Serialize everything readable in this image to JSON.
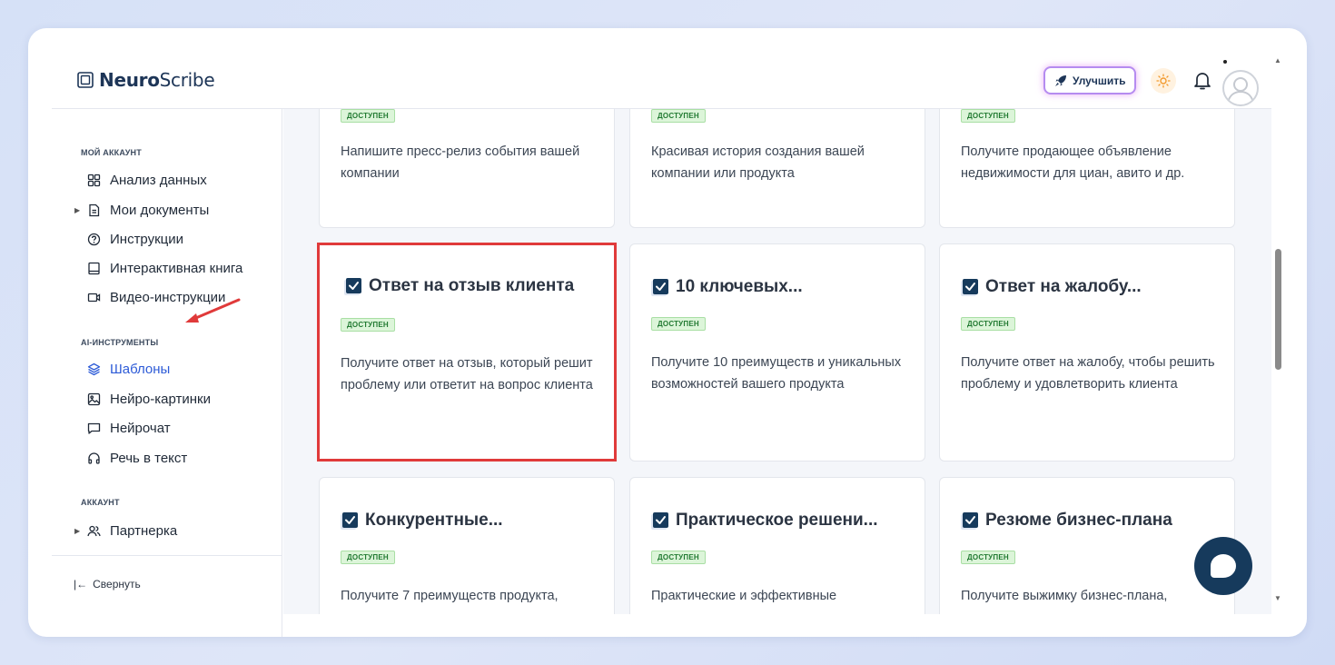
{
  "header": {
    "logo_bold": "Neuro",
    "logo_regular": "Scribe",
    "upgrade_label": "Улучшить"
  },
  "sidebar": {
    "section_account": "МОЙ АККАУНТ",
    "items_account": [
      {
        "label": "Анализ данных",
        "icon": "grid-icon"
      },
      {
        "label": "Мои документы",
        "icon": "document-icon"
      },
      {
        "label": "Инструкции",
        "icon": "help-circle-icon"
      },
      {
        "label": "Интерактивная книга",
        "icon": "book-icon"
      },
      {
        "label": "Видео-инструкции",
        "icon": "video-icon"
      }
    ],
    "section_ai": "AI-ИНСТРУМЕНТЫ",
    "items_ai": [
      {
        "label": "Шаблоны",
        "icon": "layers-icon"
      },
      {
        "label": "Нейро-картинки",
        "icon": "image-icon"
      },
      {
        "label": "Нейрочат",
        "icon": "chat-icon"
      },
      {
        "label": "Речь в текст",
        "icon": "headphones-icon"
      }
    ],
    "section_acc2": "АККАУНТ",
    "items_acc2": [
      {
        "label": "Партнерка",
        "icon": "users-icon"
      }
    ],
    "collapse_label": "Свернуть"
  },
  "cards_top": [
    {
      "badge": "ДОСТУПЕН",
      "desc": "Напишите пресс-релиз события вашей компании"
    },
    {
      "badge": "ДОСТУПЕН",
      "desc": "Красивая история создания вашей компании или продукта"
    },
    {
      "badge": "ДОСТУПЕН",
      "desc": "Получите продающее объявление недвижимости для циан, авито и др."
    }
  ],
  "cards_mid": [
    {
      "title": "Ответ на отзыв клиента",
      "badge": "ДОСТУПЕН",
      "desc": "Получите ответ на отзыв, который решит проблему или ответит на вопрос клиента"
    },
    {
      "title": "10 ключевых...",
      "badge": "ДОСТУПЕН",
      "desc": "Получите 10 преимуществ и уникальных возможностей вашего продукта"
    },
    {
      "title": "Ответ на жалобу...",
      "badge": "ДОСТУПЕН",
      "desc": "Получите ответ на жалобу, чтобы решить проблему и удовлетворить клиента"
    }
  ],
  "cards_bot": [
    {
      "title": "Конкурентные...",
      "badge": "ДОСТУПЕН",
      "desc": "Получите 7 преимуществ продукта,"
    },
    {
      "title": "Практическое решени...",
      "badge": "ДОСТУПЕН",
      "desc": "Практические и эффективные"
    },
    {
      "title": "Резюме бизнес-плана",
      "badge": "ДОСТУПЕН",
      "desc": "Получите выжимку бизнес-плана,"
    }
  ],
  "colors": {
    "accent": "#2d5bd7",
    "highlight": "#e03a3a",
    "badge_bg": "#dcf5d9",
    "chat_button": "#163a5c"
  }
}
